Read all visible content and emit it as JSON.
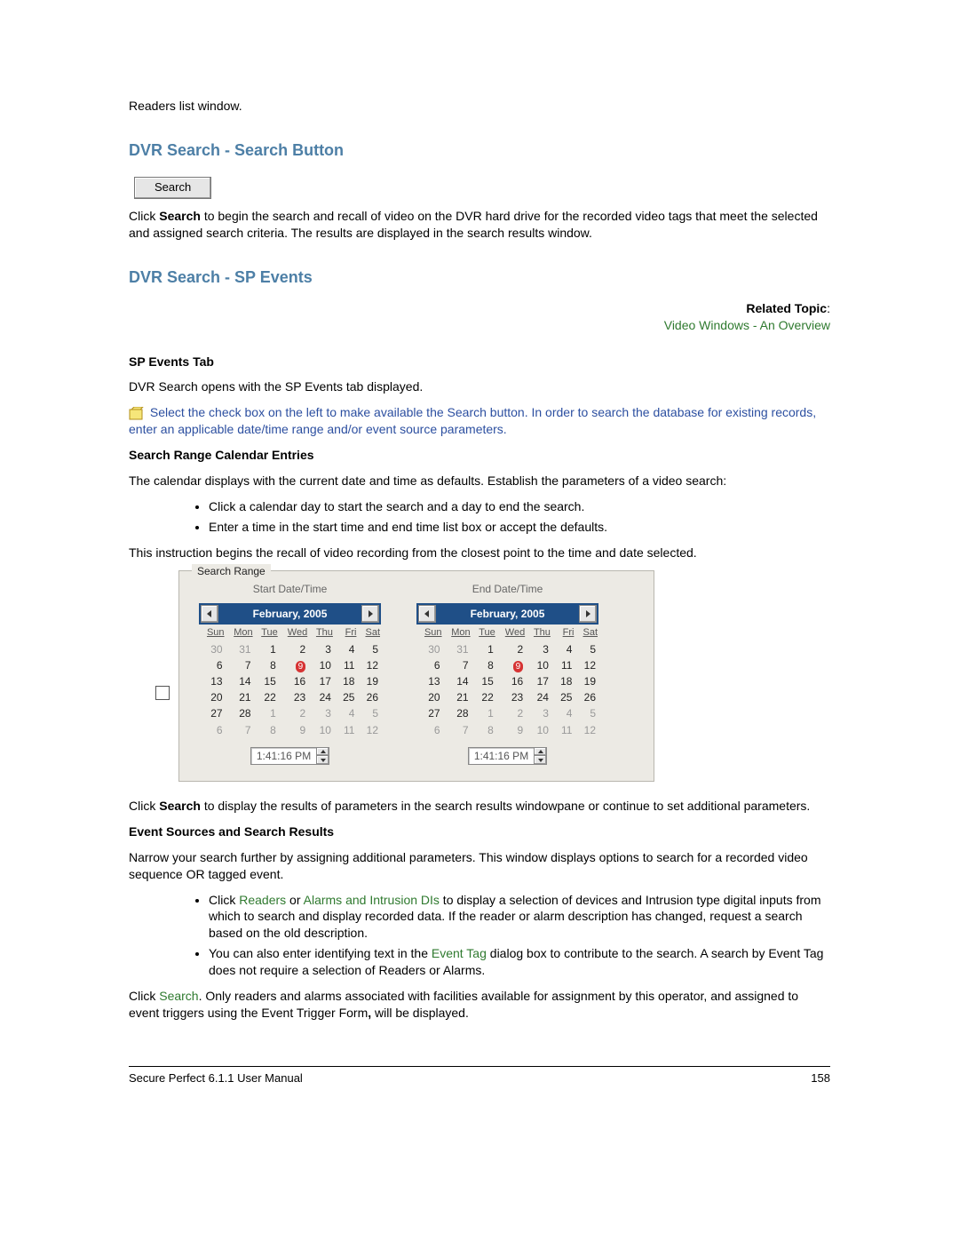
{
  "intro_line": "Readers list window.",
  "sec1": {
    "heading": "DVR Search - Search Button",
    "button_label": "Search",
    "para_parts": [
      "Click ",
      "Search",
      " to begin the search and recall of video on the DVR hard drive for the recorded video tags that meet the selected and assigned search criteria. The results are displayed in the search results window."
    ]
  },
  "sec2": {
    "heading": "DVR Search - SP Events",
    "related_label": "Related Topic",
    "related_link": "Video Windows - An Overview",
    "sp_heading": "SP Events Tab",
    "sp_para": "DVR Search opens with the SP Events tab displayed.",
    "note": "Select the check box on the left to make available the Search button. In order to search the database for existing records, enter an applicable date/time range and/or event source parameters.",
    "cal_heading": "Search Range Calendar Entries",
    "cal_para": "The calendar displays with the current date and time as defaults. Establish the parameters of a video search:",
    "cal_bullets": [
      "Click a calendar day to start the search and a day to end the search.",
      "Enter a time in the start time and end time list box or accept the defaults."
    ],
    "cal_after": "This instruction begins the recall of video recording from the closest point to the time and date selected."
  },
  "search_range": {
    "legend": "Search Range",
    "start_label": "Start Date/Time",
    "end_label": "End Date/Time",
    "month_label": "February, 2005",
    "dow": [
      "Sun",
      "Mon",
      "Tue",
      "Wed",
      "Thu",
      "Fri",
      "Sat"
    ],
    "weeks": [
      [
        {
          "d": "30",
          "dim": true
        },
        {
          "d": "31",
          "dim": true
        },
        {
          "d": "1"
        },
        {
          "d": "2"
        },
        {
          "d": "3"
        },
        {
          "d": "4"
        },
        {
          "d": "5"
        }
      ],
      [
        {
          "d": "6"
        },
        {
          "d": "7"
        },
        {
          "d": "8"
        },
        {
          "d": "9",
          "sel": true
        },
        {
          "d": "10"
        },
        {
          "d": "11"
        },
        {
          "d": "12"
        }
      ],
      [
        {
          "d": "13"
        },
        {
          "d": "14"
        },
        {
          "d": "15"
        },
        {
          "d": "16"
        },
        {
          "d": "17"
        },
        {
          "d": "18"
        },
        {
          "d": "19"
        }
      ],
      [
        {
          "d": "20"
        },
        {
          "d": "21"
        },
        {
          "d": "22"
        },
        {
          "d": "23"
        },
        {
          "d": "24"
        },
        {
          "d": "25"
        },
        {
          "d": "26"
        }
      ],
      [
        {
          "d": "27"
        },
        {
          "d": "28"
        },
        {
          "d": "1",
          "dim": true
        },
        {
          "d": "2",
          "dim": true
        },
        {
          "d": "3",
          "dim": true
        },
        {
          "d": "4",
          "dim": true
        },
        {
          "d": "5",
          "dim": true
        }
      ],
      [
        {
          "d": "6",
          "dim": true
        },
        {
          "d": "7",
          "dim": true
        },
        {
          "d": "8",
          "dim": true
        },
        {
          "d": "9",
          "dim": true
        },
        {
          "d": "10",
          "dim": true
        },
        {
          "d": "11",
          "dim": true
        },
        {
          "d": "12",
          "dim": true
        }
      ]
    ],
    "time_value": "1:41:16 PM"
  },
  "after_panel": {
    "para1_parts": [
      "Click ",
      "Search",
      " to display the results of parameters in the search results windowpane or continue to set additional parameters."
    ],
    "es_heading": "Event Sources and Search Results",
    "es_para": "Narrow your search further by assigning additional parameters. This window displays options to search for a recorded video sequence OR tagged event.",
    "bullets": [
      {
        "pre": "Click ",
        "l1": "Readers",
        "mid": " or ",
        "l2": "Alarms and Intrusion DIs",
        "post": " to display a selection of devices and Intrusion type digital inputs from which to search and display recorded data. If the reader or alarm description has changed, request a search based on the old description."
      },
      {
        "pre": "You can also enter identifying text in the ",
        "l1": "Event Tag",
        "post": " dialog box to contribute to the search. A search by Event Tag does not require a selection of Readers or Alarms."
      }
    ],
    "final_parts": [
      "Click ",
      "Search",
      ". Only readers and alarms associated with facilities available for assignment by this operator, and assigned to event triggers using the Event Trigger Form",
      ",",
      " will be displayed."
    ]
  },
  "footer": {
    "left": "Secure Perfect 6.1.1 User Manual",
    "right": "158"
  }
}
